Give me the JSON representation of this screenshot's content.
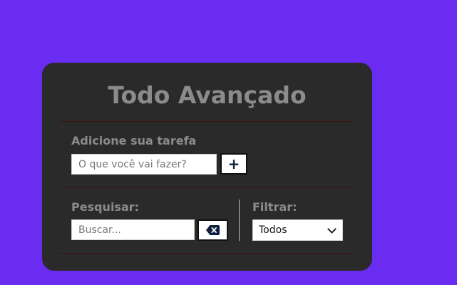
{
  "app": {
    "title": "Todo Avançado"
  },
  "add_section": {
    "label": "Adicione sua tarefa",
    "input_placeholder": "O que você vai fazer?",
    "input_value": "",
    "add_button_label": "+"
  },
  "search_section": {
    "label": "Pesquisar:",
    "input_placeholder": "Buscar...",
    "input_value": "",
    "erase_icon": "backspace-icon"
  },
  "filter_section": {
    "label": "Filtrar:",
    "selected": "Todos"
  },
  "colors": {
    "background": "#6a2cf1",
    "card": "#2a2a2a",
    "text_muted": "#8b8b8b",
    "icon": "#0d2040"
  }
}
